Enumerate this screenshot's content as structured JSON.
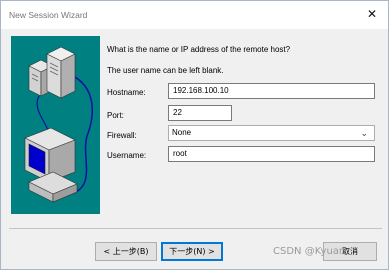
{
  "window": {
    "title": "New Session Wizard",
    "close_glyph": "✕"
  },
  "wizard": {
    "question": "What is the name or IP address of the remote host?",
    "note": "The user name can be left blank.",
    "fields": {
      "hostname": {
        "label": "Hostname:",
        "value": "192.168.100.10"
      },
      "port": {
        "label": "Port:",
        "value": "22"
      },
      "firewall": {
        "label": "Firewall:",
        "value": "None"
      },
      "username": {
        "label": "Username:",
        "value": "root"
      }
    }
  },
  "buttons": {
    "back": "< 上一步(B)",
    "next": "下一步(N) >",
    "cancel": "取消"
  },
  "watermark": "CSDN @Kyuan",
  "colors": {
    "art_background": "#008080",
    "screen": "#0000cc",
    "accent": "#0078d7"
  },
  "icons": {
    "art": "network-computers-illustration",
    "firewall_dropdown": "chevron-down-icon"
  }
}
